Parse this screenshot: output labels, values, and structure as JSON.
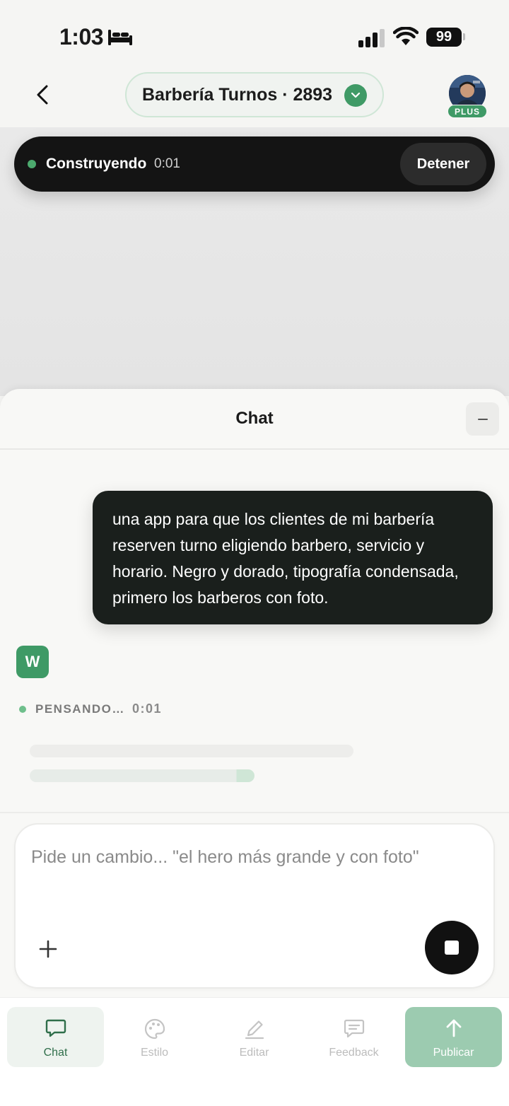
{
  "status_bar": {
    "time": "1:03",
    "battery": "99"
  },
  "header": {
    "project_title": "Barbería Turnos · 2893",
    "plan_badge": "PLUS"
  },
  "build_status": {
    "label": "Construyendo",
    "elapsed": "0:01",
    "stop_label": "Detener"
  },
  "chat": {
    "title": "Chat",
    "user_message": "una app para que los clientes de mi barbería reserven turno eligiendo barbero, servicio y horario. Negro y dorado, tipografía condensada, primero los barberos con foto.",
    "assistant_initial": "W",
    "thinking_label": "PENSANDO…",
    "thinking_time": "0:01"
  },
  "composer": {
    "placeholder": "Pide un cambio... \"el hero más grande y con foto\""
  },
  "nav": {
    "chat": "Chat",
    "style": "Estilo",
    "edit": "Editar",
    "feedback": "Feedback",
    "publish": "Publicar"
  },
  "colors": {
    "accent": "#3f9a66",
    "dark": "#141414",
    "publish_bg": "#9ccbb0"
  }
}
